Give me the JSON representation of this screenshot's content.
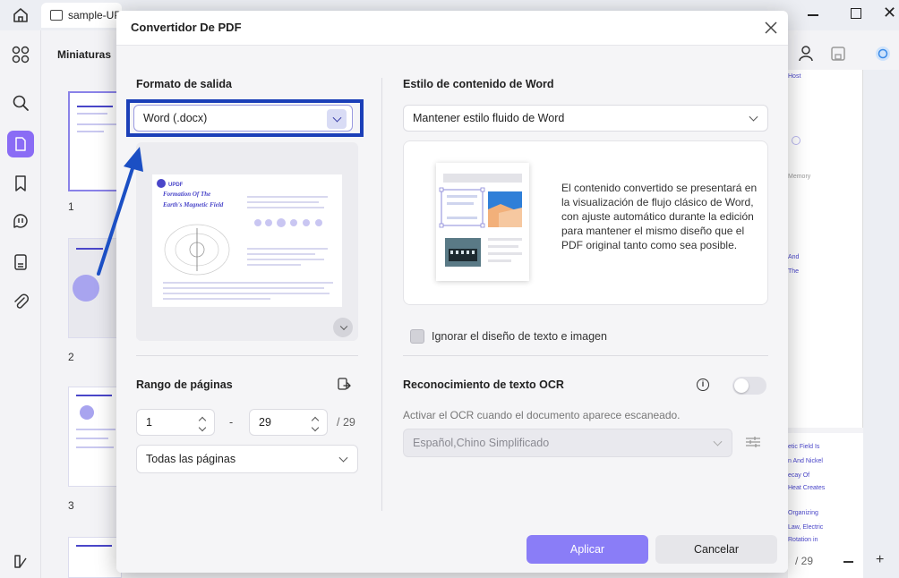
{
  "app": {
    "tab_title": "sample-UP",
    "thumbnails_title": "Miniaturas",
    "thumb_numbers": [
      "1",
      "2",
      "3"
    ],
    "page_counter": "/ 29",
    "doc_snippets": [
      "Host",
      "Memory",
      "And",
      "The",
      "etic Field Is",
      "n And Nickel",
      "ecay Of",
      "Heat Creates",
      "Organizing",
      "Law, Electric",
      "Rotation in"
    ]
  },
  "dialog": {
    "title": "Convertidor De PDF",
    "output_format": {
      "label": "Formato de salida",
      "value": "Word (.docx)"
    },
    "preview": {
      "logo": "UPDF",
      "title_line1": "Formation Of The",
      "title_line2": "Earth's Magnetic Field"
    },
    "page_range": {
      "label": "Rango de páginas",
      "from": "1",
      "separator": "-",
      "to": "29",
      "total": "/ 29",
      "mode": "Todas las páginas"
    },
    "word_style": {
      "label": "Estilo de contenido de Word",
      "value": "Mantener estilo fluido de Word",
      "description": "El contenido convertido se presentará en la visualización de flujo clásico de Word, con ajuste automático durante la edición para mantener el mismo diseño que el PDF original tanto como sea posible."
    },
    "ignore_layout": {
      "label": "Ignorar el diseño de texto e imagen",
      "checked": false
    },
    "ocr": {
      "label": "Reconocimiento de texto OCR",
      "enabled": false,
      "description": "Activar el OCR cuando el documento aparece escaneado.",
      "language": "Español,Chino Simplificado"
    },
    "buttons": {
      "apply": "Aplicar",
      "cancel": "Cancelar"
    }
  },
  "colors": {
    "accent": "#8a6cf5",
    "apply_button": "#8a7df7",
    "highlight_box": "#1b3fb8",
    "annotation_arrow": "#1b4fc4"
  },
  "icons": [
    "home-icon",
    "document-tab-icon",
    "minimize-icon",
    "maximize-icon",
    "close-icon",
    "thumbnails-grid-icon",
    "search-icon",
    "page-icon",
    "bookmark-icon",
    "comment-icon",
    "stamp-icon",
    "attachment-icon",
    "layers-icon",
    "chevron-down-icon",
    "swap-pages-icon",
    "info-icon",
    "ocr-settings-icon",
    "user-icon",
    "save-icon",
    "ai-assistant-icon"
  ]
}
